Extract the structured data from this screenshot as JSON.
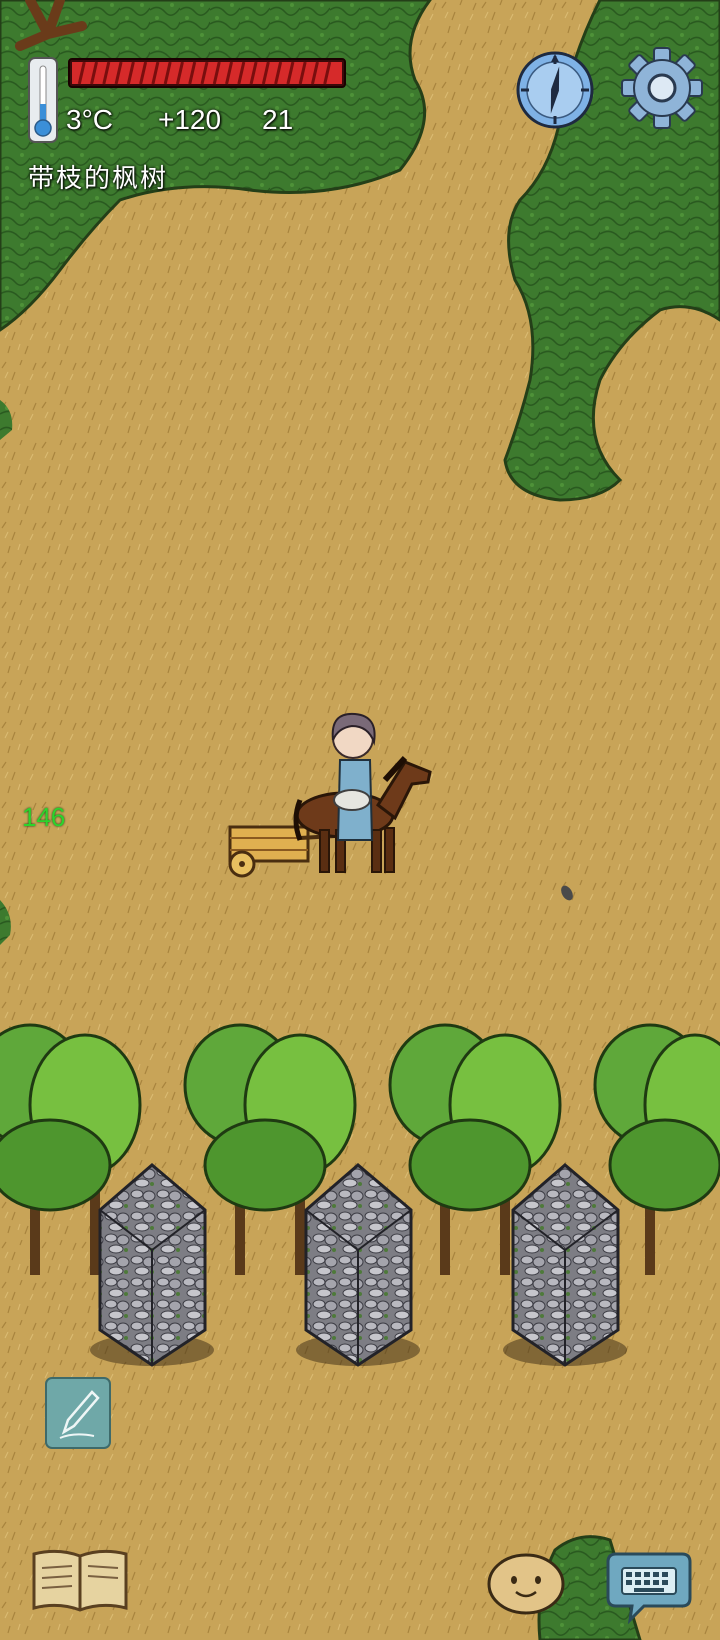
{
  "hud": {
    "temperature": "3°C",
    "score": "+120",
    "count": "21",
    "object_name": "带枝的枫树",
    "health_fraction": 1.0
  },
  "world": {
    "distance_label": "146"
  },
  "icons": {
    "thermometer": "thermometer-icon",
    "compass": "compass-icon",
    "settings": "gear-icon",
    "edit": "pencil-icon",
    "journal": "book-icon",
    "emote": "emote-face-icon",
    "chat": "keyboard-chat-icon"
  },
  "colors": {
    "grass_field": "#c8a458",
    "forest": "#3d7a2e",
    "health_red": "#d62a2a",
    "distance_green": "#2cd42c",
    "ui_teal": "#6fa8a8"
  }
}
